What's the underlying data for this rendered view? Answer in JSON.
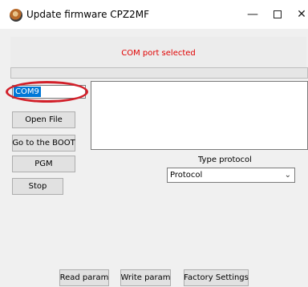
{
  "window": {
    "title": "Update firmware CPZ2MF",
    "minimize_glyph": "—",
    "close_glyph": "✕"
  },
  "status": {
    "message": "COM port selected",
    "color": "#e00000"
  },
  "progress": {
    "value": 0
  },
  "com_port": {
    "value": "COM9"
  },
  "buttons": {
    "open_file": "Open File",
    "go_to_boot": "Go to the BOOT",
    "pgm": "PGM",
    "stop": "Stop",
    "read_param": "Read param",
    "write_param": "Write param",
    "factory_settings": "Factory Settings"
  },
  "protocol": {
    "label": "Type protocol",
    "selected": "Protocol",
    "chevron": "⌄"
  },
  "log": {
    "text": ""
  },
  "colors": {
    "highlight_oval": "#d2202a",
    "selection": "#0078d7"
  }
}
